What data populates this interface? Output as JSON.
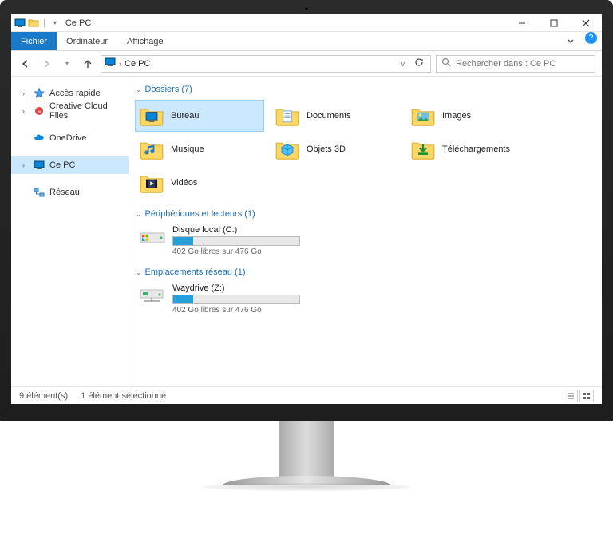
{
  "window": {
    "title": "Ce PC"
  },
  "tabs": {
    "file": "Fichier",
    "computer": "Ordinateur",
    "view": "Affichage"
  },
  "address": {
    "crumb": "Ce PC"
  },
  "search": {
    "placeholder": "Rechercher dans : Ce PC"
  },
  "sidebar": {
    "items": [
      {
        "label": "Accès rapide",
        "icon": "star",
        "expandable": true
      },
      {
        "label": "Creative Cloud Files",
        "icon": "cc",
        "expandable": true
      },
      {
        "label": "OneDrive",
        "icon": "onedrive",
        "expandable": false
      },
      {
        "label": "Ce PC",
        "icon": "pc",
        "expandable": true,
        "selected": true
      },
      {
        "label": "Réseau",
        "icon": "network",
        "expandable": false
      }
    ]
  },
  "groups": {
    "folders": {
      "header": "Dossiers (7)",
      "items": [
        {
          "label": "Bureau",
          "selected": true,
          "overlay": "desktop"
        },
        {
          "label": "Documents",
          "overlay": "doc"
        },
        {
          "label": "Images",
          "overlay": "image"
        },
        {
          "label": "Musique",
          "overlay": "music"
        },
        {
          "label": "Objets 3D",
          "overlay": "cube"
        },
        {
          "label": "Téléchargements",
          "overlay": "download"
        },
        {
          "label": "Vidéos",
          "overlay": "video"
        }
      ]
    },
    "drives": {
      "header": "Périphériques et lecteurs (1)",
      "items": [
        {
          "name": "Disque local (C:)",
          "free_label": "402 Go libres sur 476 Go",
          "fill_percent": 16
        }
      ]
    },
    "network": {
      "header": "Emplacements réseau (1)",
      "items": [
        {
          "name": "Waydrive (Z:)",
          "free_label": "402 Go libres sur 476 Go",
          "fill_percent": 16
        }
      ]
    }
  },
  "status": {
    "count": "9 élément(s)",
    "selection": "1 élément sélectionné"
  }
}
